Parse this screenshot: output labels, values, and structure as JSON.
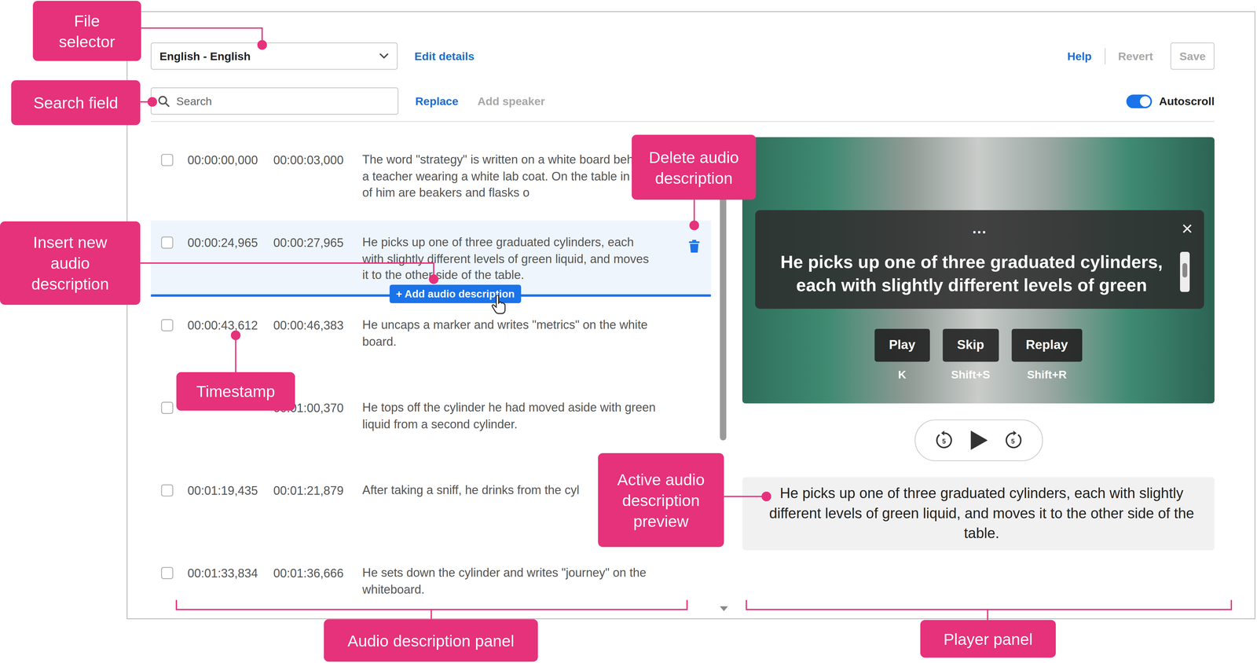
{
  "toolbar": {
    "file_selector": "English - English",
    "edit_details": "Edit details",
    "help": "Help",
    "revert": {
      "label": "Revert",
      "disabled": true
    },
    "save": {
      "label": "Save",
      "disabled": true
    }
  },
  "search": {
    "placeholder": "Search",
    "replace": "Replace",
    "add_speaker": {
      "label": "Add speaker",
      "disabled": true
    },
    "autoscroll": {
      "label": "Autoscroll",
      "on": true
    }
  },
  "descriptions": [
    {
      "checked": false,
      "selected": false,
      "start": "00:00:00,000",
      "end": "00:00:03,000",
      "text": "The word \"strategy\" is written on a white board behind a teacher wearing a white lab coat. On the table in front of him are beakers and flasks o"
    },
    {
      "checked": false,
      "selected": true,
      "start": "00:00:24,965",
      "end": "00:00:27,965",
      "text": "He picks up one of three graduated cylinders, each with slightly different levels of green liquid, and moves it to the other side of the table."
    },
    {
      "checked": false,
      "selected": false,
      "start": "00:00:43,612",
      "end": "00:00:46,383",
      "text": "He uncaps a marker and writes \"metrics\" on the white board."
    },
    {
      "checked": false,
      "selected": false,
      "end": "00:01:00,370",
      "text": "He tops off the cylinder he had moved aside with green liquid from a second cylinder."
    },
    {
      "checked": false,
      "selected": false,
      "start": "00:01:19,435",
      "end": "00:01:21,879",
      "text": "After taking a sniff, he drinks from the cyl"
    },
    {
      "checked": false,
      "selected": false,
      "start": "00:01:33,834",
      "end": "00:01:36,666",
      "text": "He sets down the cylinder and writes \"journey\" on the whiteboard."
    }
  ],
  "insert_button": "+ Add audio description",
  "player": {
    "menu": "...",
    "close": "×",
    "caption": "He picks up one of three graduated cylinders, each with slightly different levels of green",
    "buttons": [
      {
        "label": "Play",
        "shortcut": "K"
      },
      {
        "label": "Skip",
        "shortcut": "Shift+S"
      },
      {
        "label": "Replay",
        "shortcut": "Shift+R"
      }
    ],
    "rewind": "5",
    "forward": "5",
    "preview": "He picks up one of three graduated cylinders, each with slightly different levels of green liquid, and moves it to the other side of the table."
  },
  "callouts": [
    {
      "label": "File selector"
    },
    {
      "label": "Search field"
    },
    {
      "label": "Delete audio description"
    },
    {
      "label": "Insert new audio description"
    },
    {
      "label": "Timestamp"
    },
    {
      "label": "Active audio description preview"
    },
    {
      "label": "Audio description panel"
    },
    {
      "label": "Player panel"
    }
  ]
}
